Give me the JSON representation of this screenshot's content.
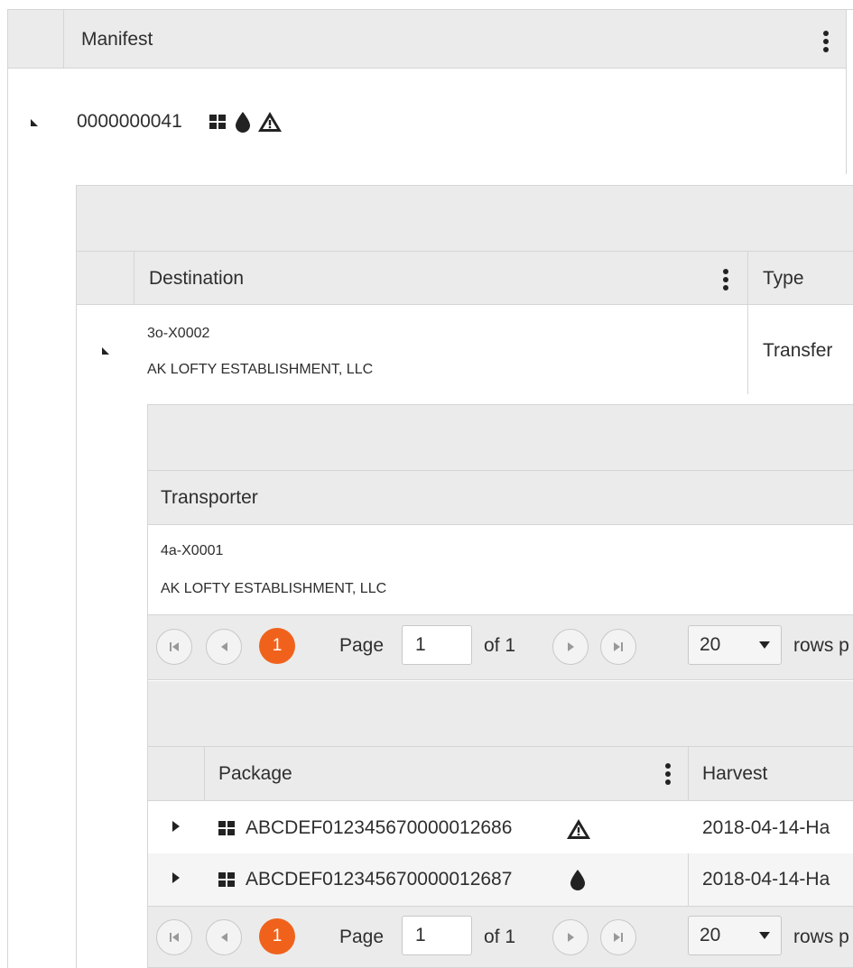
{
  "manifest": {
    "header": "Manifest",
    "id": "0000000041"
  },
  "destination": {
    "header_destination": "Destination",
    "header_type": "Type",
    "code": "3o-X0002",
    "name": "AK LOFTY ESTABLISHMENT, LLC",
    "type": "Transfer"
  },
  "transporter": {
    "header": "Transporter",
    "code": "4a-X0001",
    "name": "AK LOFTY ESTABLISHMENT, LLC"
  },
  "pager1": {
    "current": "1",
    "page_label": "Page",
    "page_value": "1",
    "of_label": "of 1",
    "rows_value": "20",
    "rows_label": "rows p"
  },
  "packages": {
    "header_package": "Package",
    "header_harvest": "Harvest",
    "rows": [
      {
        "package": "ABCDEF012345670000012686",
        "harvest": "2018-04-14-Ha",
        "icon": "warning-icon"
      },
      {
        "package": "ABCDEF012345670000012687",
        "harvest": "2018-04-14-Ha",
        "icon": "drop-icon"
      }
    ]
  },
  "pager2": {
    "current": "1",
    "page_label": "Page",
    "page_value": "1",
    "of_label": "of 1",
    "rows_value": "20",
    "rows_label": "rows p"
  }
}
